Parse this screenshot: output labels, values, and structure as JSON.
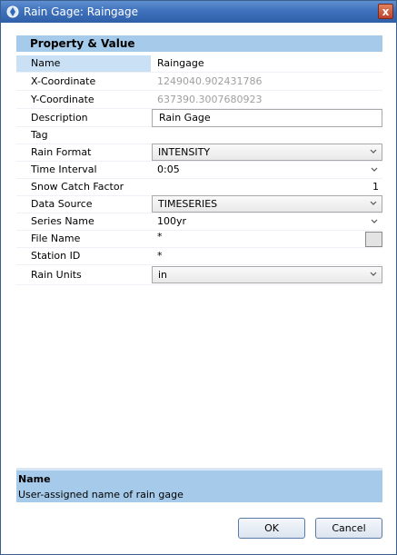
{
  "window": {
    "title": "Rain Gage: Raingage",
    "close_label": "x"
  },
  "grid": {
    "header": "Property  &  Value",
    "rows": [
      {
        "name": "Name",
        "value": "Raingage"
      },
      {
        "name": "X-Coordinate",
        "value": "1249040.902431786"
      },
      {
        "name": "Y-Coordinate",
        "value": "637390.3007680923"
      },
      {
        "name": "Description",
        "value": "Rain Gage"
      },
      {
        "name": "Tag",
        "value": ""
      },
      {
        "name": "Rain Format",
        "value": "INTENSITY"
      },
      {
        "name": "Time Interval",
        "value": "0:05"
      },
      {
        "name": "Snow Catch Factor",
        "value": "1"
      },
      {
        "name": "Data Source",
        "value": "TIMESERIES"
      },
      {
        "name": "Series Name",
        "value": "100yr"
      },
      {
        "name": "File Name",
        "value": "*"
      },
      {
        "name": "Station ID",
        "value": "*"
      },
      {
        "name": "Rain Units",
        "value": "in"
      }
    ]
  },
  "description_panel": {
    "title": "Name",
    "text": "User-assigned name of rain gage"
  },
  "buttons": {
    "ok": "OK",
    "cancel": "Cancel"
  },
  "colors": {
    "titlebar": "#3f72bd",
    "header_bg": "#a6cbea",
    "selected_bg": "#c9e0f5"
  }
}
